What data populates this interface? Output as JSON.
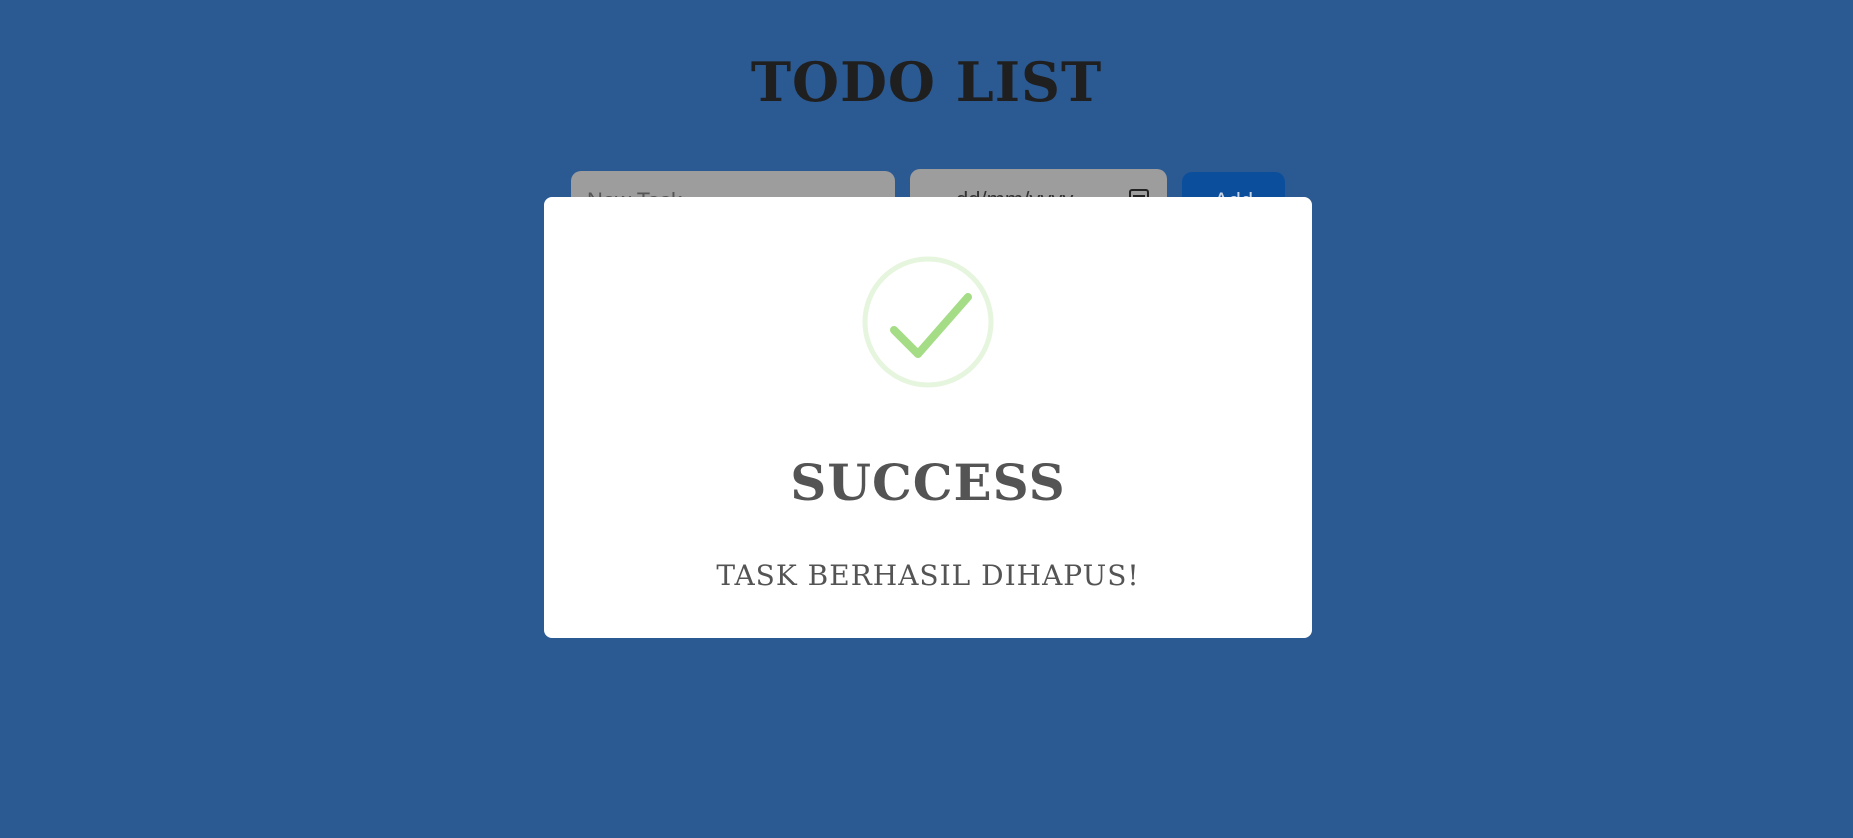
{
  "app": {
    "title": "TODO LIST"
  },
  "form": {
    "task_placeholder": "New Task",
    "date_placeholder": "dd/mm/yyyy",
    "add_label": "Add"
  },
  "modal": {
    "icon": "check-icon",
    "title": "SUCCESS",
    "message": "TASK BERHASIL DIHAPUS!"
  },
  "colors": {
    "background": "#2b5992",
    "input_background": "#9d9d9d",
    "add_button": "#0b4f9c",
    "success_check": "#a5dc86",
    "success_ring": "#e6f5dd",
    "modal_text": "#545454"
  }
}
